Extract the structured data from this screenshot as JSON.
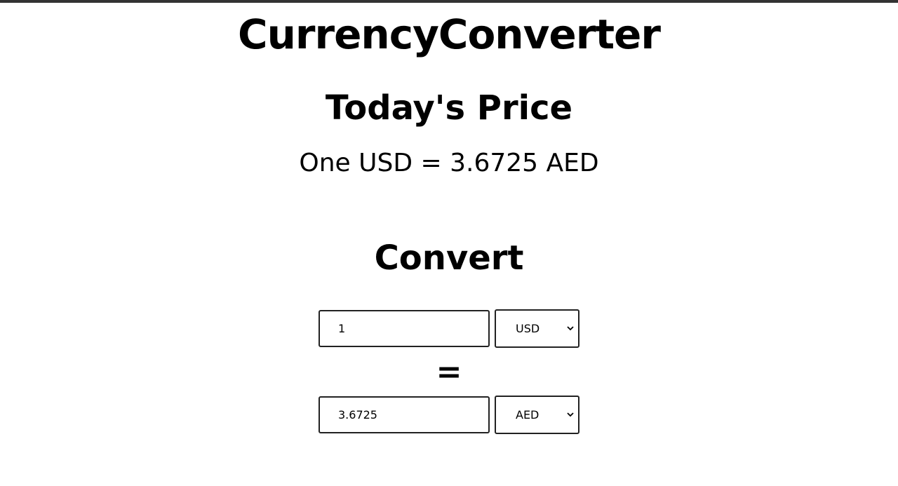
{
  "app": {
    "title": "CurrencyConverter"
  },
  "price": {
    "heading": "Today's Price",
    "rate_text": "One USD = 3.6725 AED"
  },
  "convert": {
    "heading": "Convert",
    "from_amount": "1",
    "from_currency": "USD",
    "equals": "=",
    "to_amount": "3.6725",
    "to_currency": "AED"
  },
  "icons": {
    "select_arrow": "chevron-down-icon"
  },
  "colors": {
    "top_border": "#333333",
    "text": "#000000",
    "border": "#222222",
    "background": "#ffffff"
  }
}
